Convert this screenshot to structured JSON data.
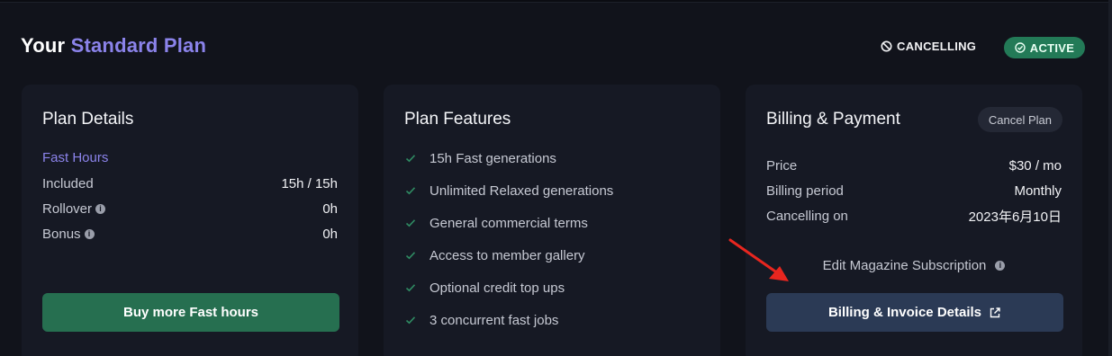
{
  "header": {
    "title_prefix": "Your",
    "plan_name": "Standard Plan",
    "cancelling_label": "CANCELLING",
    "active_label": "ACTIVE"
  },
  "plan_details": {
    "title": "Plan Details",
    "section_label": "Fast Hours",
    "rows": [
      {
        "label": "Included",
        "value": "15h / 15h"
      },
      {
        "label": "Rollover",
        "value": "0h"
      },
      {
        "label": "Bonus",
        "value": "0h"
      }
    ],
    "button_label": "Buy more Fast hours"
  },
  "plan_features": {
    "title": "Plan Features",
    "items": [
      "15h Fast generations",
      "Unlimited Relaxed generations",
      "General commercial terms",
      "Access to member gallery",
      "Optional credit top ups",
      "3 concurrent fast jobs"
    ]
  },
  "billing": {
    "title": "Billing & Payment",
    "cancel_label": "Cancel Plan",
    "rows": [
      {
        "label": "Price",
        "value": "$30 / mo"
      },
      {
        "label": "Billing period",
        "value": "Monthly"
      },
      {
        "label": "Cancelling on",
        "value": "2023年6月10日"
      }
    ],
    "edit_magazine_label": "Edit Magazine Subscription",
    "button_label": "Billing & Invoice Details"
  },
  "colors": {
    "accent": "#8b83ea",
    "active_badge": "#237a57",
    "green_button": "#266f50",
    "slate_button": "#2b3a55",
    "annotation_arrow": "#e8261f"
  },
  "icons": {
    "cancelling": "ban-icon",
    "active": "check-circle-icon",
    "feature": "check-icon",
    "info": "info-icon",
    "external": "external-link-icon"
  }
}
